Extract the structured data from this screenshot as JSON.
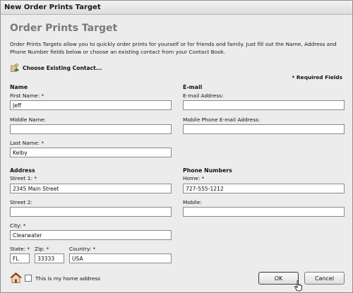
{
  "window": {
    "title": "New Order Prints Target"
  },
  "heading": "Order Prints Target",
  "intro": "Order Prints Targets allow you to quickly order prints for yourself or for friends and family. Just fill out the Name, Address and Phone Number fields below or choose an existing contact from your Contact Book.",
  "choose_contact": "Choose Existing Contact...",
  "required_note": "* Required Fields",
  "name": {
    "section": "Name",
    "first_label": "First Name: *",
    "first_value": "Jeff",
    "middle_label": "Middle Name:",
    "middle_value": "",
    "last_label": "Last Name: *",
    "last_value": "Kelby"
  },
  "email": {
    "section": "E-mail",
    "address_label": "E-mail Address:",
    "address_value": "",
    "mobile_label": "Mobile Phone E-mail Address:",
    "mobile_value": ""
  },
  "address": {
    "section": "Address",
    "street1_label": "Street 1: *",
    "street1_value": "2345 Main Street",
    "street2_label": "Street 2:",
    "street2_value": "",
    "city_label": "City: *",
    "city_value": "Clearwater",
    "state_label": "State: *",
    "state_value": "FL",
    "zip_label": "Zip: *",
    "zip_value": "33333",
    "country_label": "Country: *",
    "country_value": "USA"
  },
  "phone": {
    "section": "Phone Numbers",
    "home_label": "Home: *",
    "home_value": "727-555-1212",
    "mobile_label": "Mobile:",
    "mobile_value": ""
  },
  "home_address_checkbox": {
    "label": "This is my home address",
    "checked": false
  },
  "buttons": {
    "ok": "OK",
    "cancel": "Cancel"
  }
}
